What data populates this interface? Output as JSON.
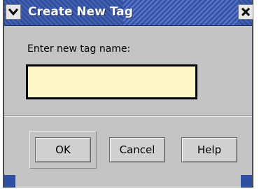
{
  "dialog": {
    "title": "Create New Tag",
    "prompt": "Enter new tag name:",
    "input_value": "",
    "input_placeholder": ""
  },
  "buttons": {
    "ok": "OK",
    "cancel": "Cancel",
    "help": "Help"
  },
  "icons": {
    "menu": "chevron-down-icon",
    "close": "close-icon"
  },
  "colors": {
    "titlebar": "#2f4fa3",
    "window_bg": "#c4c4c4",
    "input_bg": "#fff7c6"
  }
}
